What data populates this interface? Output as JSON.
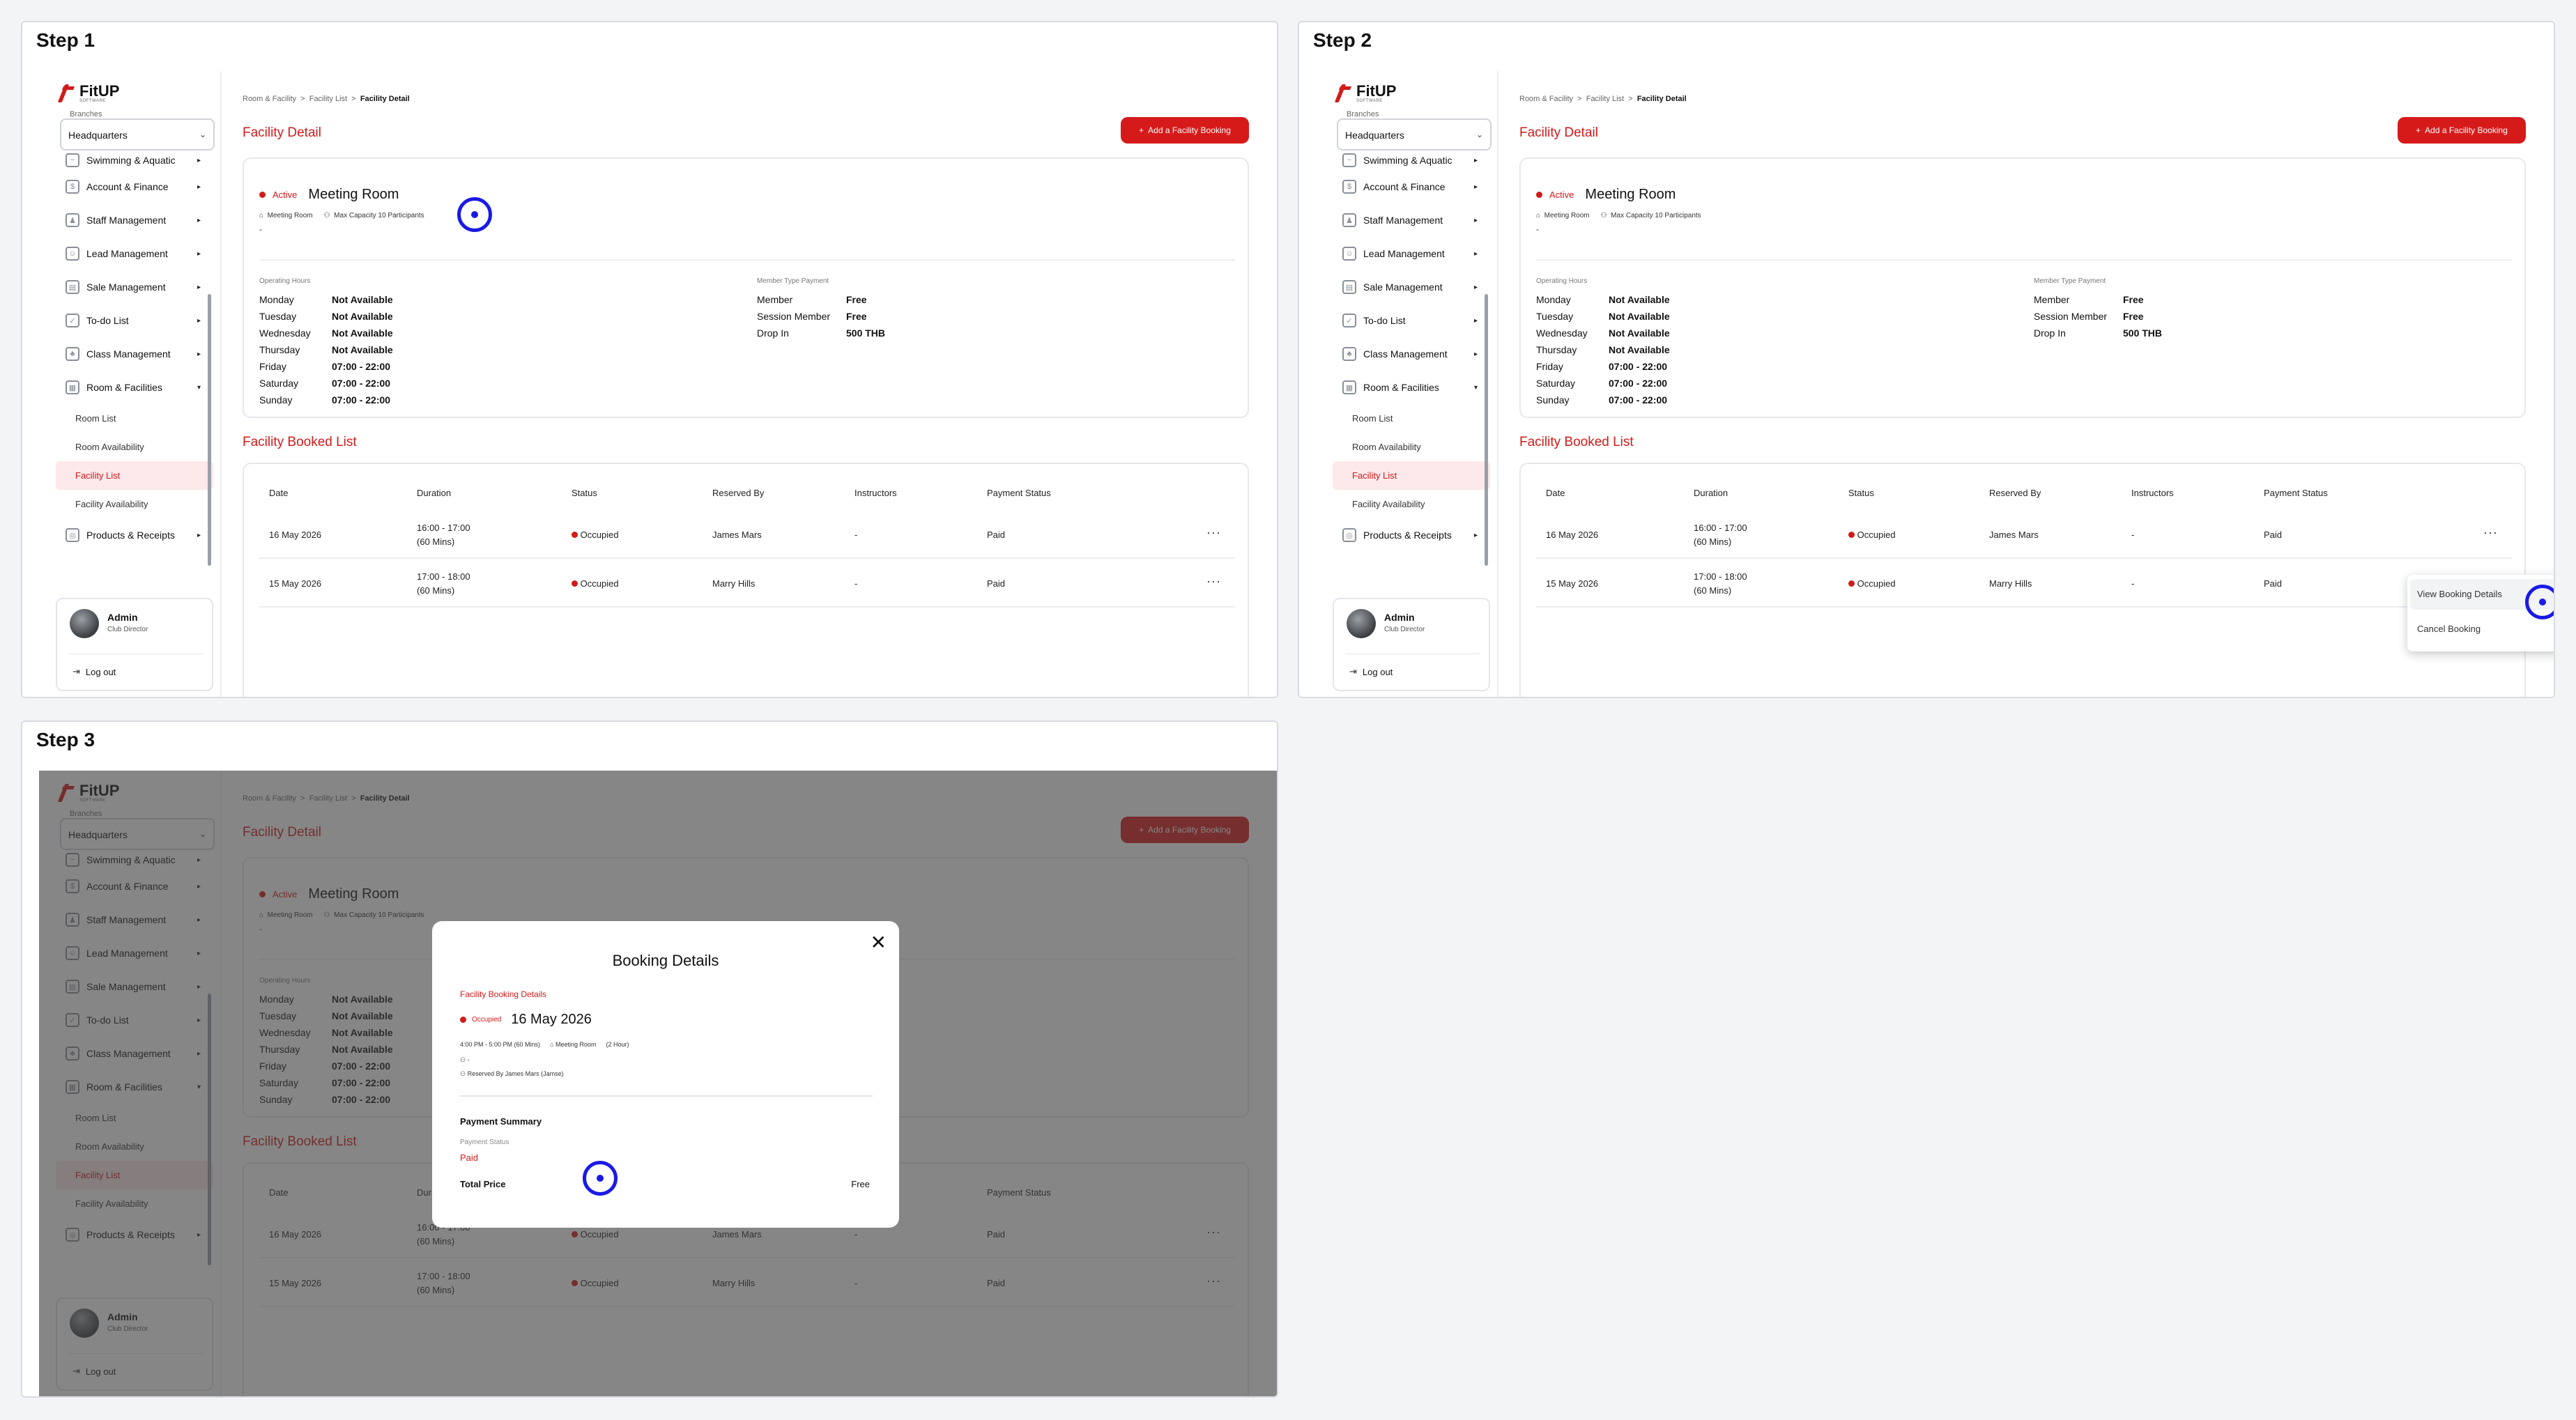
{
  "steps": [
    {
      "title": "Step 1"
    },
    {
      "title": "Step 2"
    },
    {
      "title": "Step 3"
    }
  ],
  "app": {
    "logo_text": "FitUP",
    "logo_sub": "SOFTWARE"
  },
  "sidebar": {
    "branch_label": "Branches",
    "branch_value": "Headquarters",
    "items": [
      {
        "label": "Swimming & Aquatic",
        "icon": "swim-icon"
      },
      {
        "label": "Account & Finance",
        "icon": "finance-icon"
      },
      {
        "label": "Staff Management",
        "icon": "staff-icon"
      },
      {
        "label": "Lead Management",
        "icon": "lead-icon"
      },
      {
        "label": "Sale Management",
        "icon": "sale-icon"
      },
      {
        "label": "To-do List",
        "icon": "todo-icon"
      },
      {
        "label": "Class Management",
        "icon": "class-icon"
      },
      {
        "label": "Room & Facilities",
        "icon": "room-icon"
      }
    ],
    "sub_items": [
      "Room List",
      "Room Availability",
      "Facility List",
      "Facility Availability"
    ],
    "after_item": {
      "label": "Products & Receipts",
      "icon": "products-icon"
    },
    "user": {
      "name": "Admin",
      "role": "Club Director",
      "logout": "Log out"
    }
  },
  "breadcrumb": {
    "a": "Room & Facility",
    "sep": ">",
    "b": "Facility List",
    "c": "Facility Detail"
  },
  "page_title": "Facility Detail",
  "add_button": "Add a Facility Booking",
  "facility": {
    "status": "Active",
    "name": "Meeting Room",
    "type": "Meeting Room",
    "capacity": "Max Capacity 10 Participants",
    "dash": "-",
    "hours_label": "Operating Hours",
    "hours": [
      {
        "day": "Monday",
        "value": "Not Available"
      },
      {
        "day": "Tuesday",
        "value": "Not Available"
      },
      {
        "day": "Wednesday",
        "value": "Not Available"
      },
      {
        "day": "Thursday",
        "value": "Not Available"
      },
      {
        "day": "Friday",
        "value": "07:00 - 22:00"
      },
      {
        "day": "Saturday",
        "value": "07:00 - 22:00"
      },
      {
        "day": "Sunday",
        "value": "07:00 - 22:00"
      }
    ],
    "payment_label": "Member Type Payment",
    "payments": [
      {
        "type": "Member",
        "value": "Free"
      },
      {
        "type": "Session Member",
        "value": "Free"
      },
      {
        "type": "Drop In",
        "value": "500 THB"
      }
    ]
  },
  "booked": {
    "title": "Facility Booked List",
    "headers": [
      "Date",
      "Duration",
      "Status",
      "Reserved By",
      "Instructors",
      "Payment Status"
    ],
    "rows": [
      {
        "date": "16 May 2026",
        "dur1": "16:00 - 17:00",
        "dur2": "(60 Mins)",
        "status": "Occupied",
        "reserved": "James Mars",
        "instr": "-",
        "payment": "Paid"
      },
      {
        "date": "15 May 2026",
        "dur1": "17:00 - 18:00",
        "dur2": "(60 Mins)",
        "status": "Occupied",
        "reserved": "Marry Hills",
        "instr": "-",
        "payment": "Paid"
      }
    ],
    "more": "···"
  },
  "dropdown": {
    "view": "View Booking Details",
    "cancel": "Cancel Booking"
  },
  "modal": {
    "title": "Booking Details",
    "close": "✕",
    "subtitle": "Facility Booking Details",
    "status": "Occupied",
    "date": "16 May 2026",
    "time": "4:00 PM - 5:00 PM (60 Mins)",
    "room": "Meeting Room",
    "room_hours": "(2 Hour)",
    "instructor": "-",
    "reserved": "Reserved By James Mars (Jamse)",
    "payment_summary": "Payment Summary",
    "payment_status_label": "Payment Status",
    "payment_status": "Paid",
    "total_label": "Total Price",
    "total": "Free"
  },
  "colors": {
    "accent": "#d11a1a",
    "click": "#1a1ae6"
  }
}
